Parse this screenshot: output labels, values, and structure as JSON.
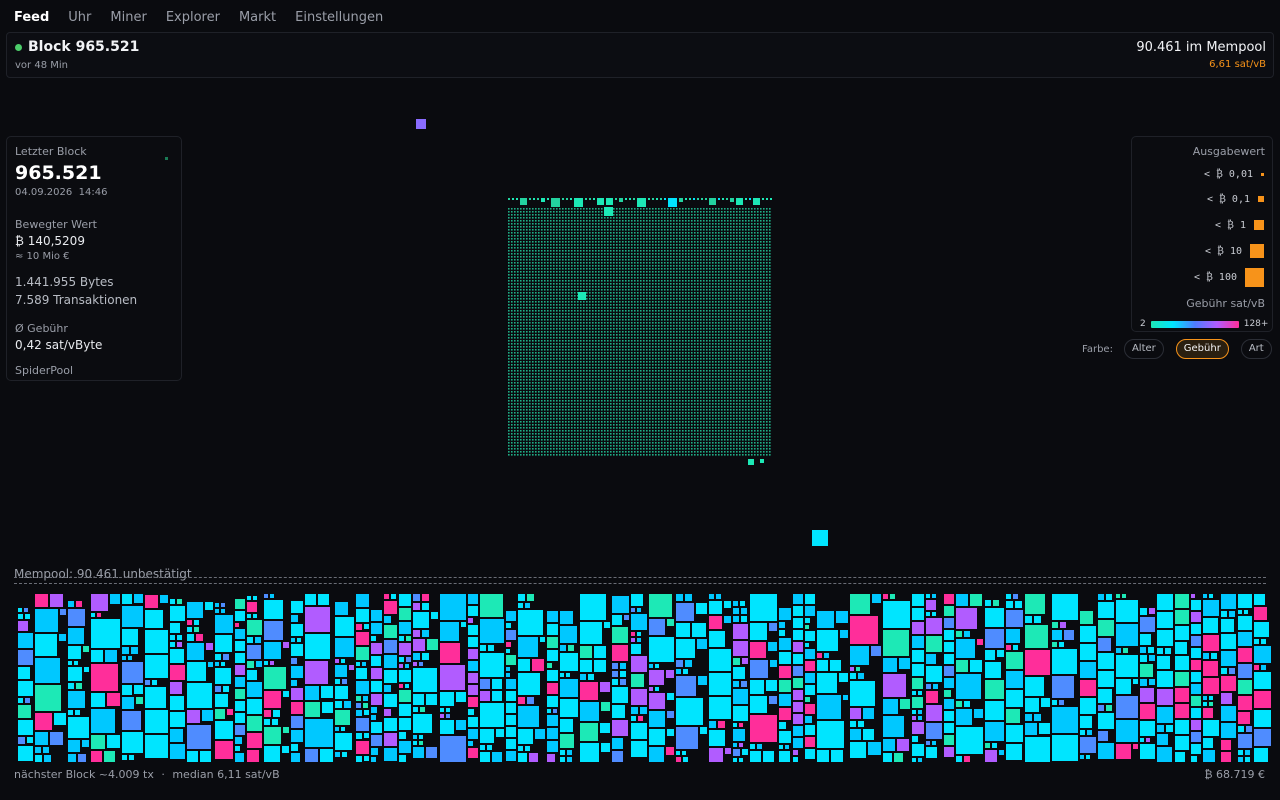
{
  "nav": {
    "tabs": [
      {
        "label": "Feed",
        "active": true
      },
      {
        "label": "Uhr",
        "active": false
      },
      {
        "label": "Miner",
        "active": false
      },
      {
        "label": "Explorer",
        "active": false
      },
      {
        "label": "Markt",
        "active": false
      },
      {
        "label": "Einstellungen",
        "active": false
      }
    ]
  },
  "header": {
    "block_title": "Block 965.521",
    "block_age": "vor 48 Min",
    "mempool_count": "90.461 im Mempool",
    "fee_rate": "6,61 sat/vB",
    "status_color": "#4ccd6a",
    "fee_color": "#f7931a"
  },
  "last_block": {
    "label": "Letzter Block",
    "height": "965.521",
    "date": "04.09.2026",
    "time": "14:46",
    "moved_label": "Bewegter Wert",
    "moved_btc": "₿ 140,5209",
    "moved_eur": "≈ 10 Mio €",
    "bytes": "1.441.955 Bytes",
    "tx_count": "7.589 Transaktionen",
    "avg_fee_label": "Ø Gebühr",
    "avg_fee": "0,42 sat/vByte",
    "pool": "SpiderPool"
  },
  "legend": {
    "title": "Ausgabewert",
    "items": [
      {
        "label": "< ₿ 0,01"
      },
      {
        "label": "< ₿ 0,1"
      },
      {
        "label": "< ₿ 1"
      },
      {
        "label": "< ₿ 10"
      },
      {
        "label": "< ₿ 100"
      }
    ],
    "fee_title": "Gebühr sat/vB",
    "fee_min": "2",
    "fee_max": "128+",
    "accent": "#f7931a"
  },
  "color_by": {
    "label": "Farbe:",
    "options": [
      {
        "label": "Alter",
        "active": false
      },
      {
        "label": "Gebühr",
        "active": true
      },
      {
        "label": "Art",
        "active": false
      }
    ]
  },
  "mempool": {
    "label": "Mempool: 90.461 unbestätigt",
    "next_block": "nächster Block ~4.009 tx",
    "separator": "·",
    "median": "median 6,11 sat/vB",
    "price": "₿ 68.719 €"
  },
  "palette": {
    "teal": "#1de9b6",
    "cyan": "#00e5ff",
    "sky": "#00c8ff",
    "blue": "#4f8cff",
    "violet": "#b15cff",
    "magenta": "#ff2e9a",
    "mint": "#23d3a0"
  }
}
